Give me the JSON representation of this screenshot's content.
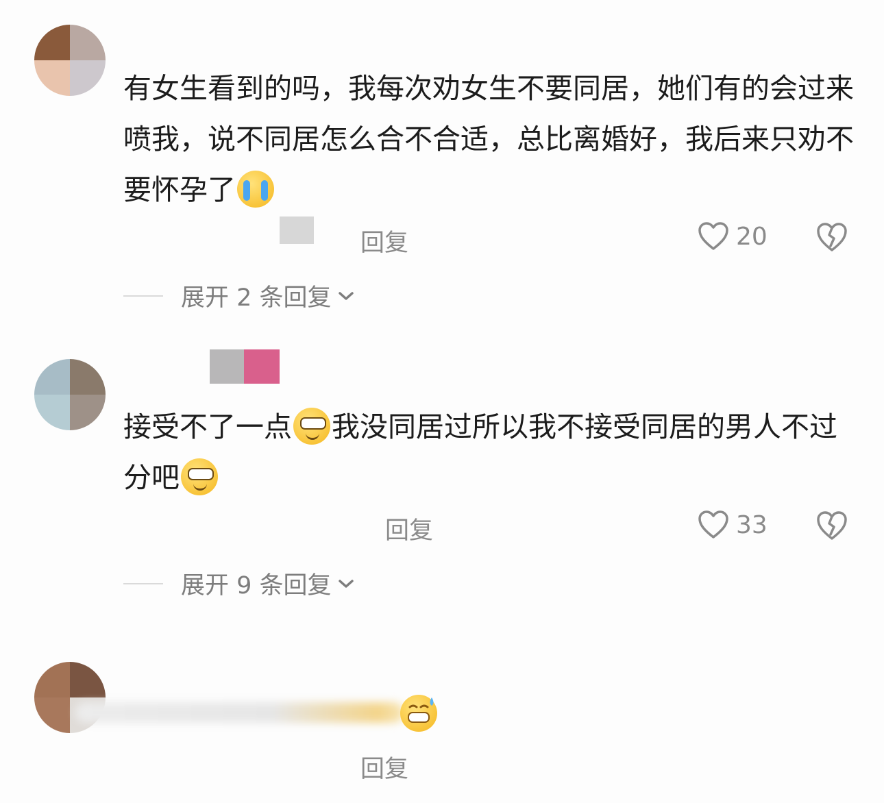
{
  "comments": [
    {
      "text_before_emoji": "有女生看到的吗，我每次劝女生不要同居，她们有的会过来喷我，说不同居怎么合不合适，总比离婚好，我后来只劝不要怀孕了",
      "emoji_1": "loudly-crying-face",
      "text_after_emoji": "",
      "reply_label": "回复",
      "like_count": "20",
      "expand_label": "展开 2 条回复"
    },
    {
      "text_before_emoji": "接受不了一点",
      "emoji_1": "smirking-face",
      "text_middle": "我没同居过所以我不接受同居的男人不过分吧",
      "emoji_2": "smirking-face",
      "reply_label": "回复",
      "like_count": "33",
      "expand_label": "展开 9 条回复"
    },
    {
      "emoji_1": "grinning-sweat-face",
      "reply_label": "回复"
    }
  ],
  "colors": {
    "background": "#fdfdfd",
    "text": "#1c1c1c",
    "meta": "#8a8a8a"
  }
}
